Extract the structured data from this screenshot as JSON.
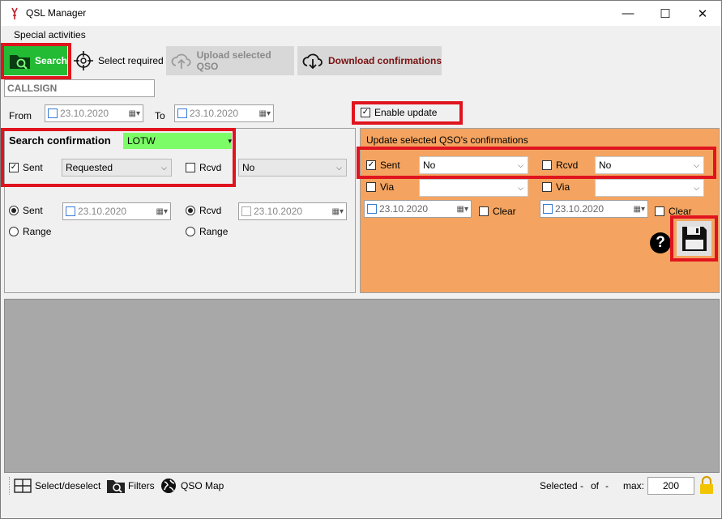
{
  "window": {
    "title": "QSL Manager",
    "minimize": "—",
    "maximize": "☐",
    "close": "✕"
  },
  "menu": {
    "special_activities": "Special activities"
  },
  "toolbar": {
    "search": "Search",
    "select_required": "Select required",
    "upload": "Upload selected QSO",
    "download": "Download confirmations"
  },
  "filters": {
    "callsign_placeholder": "CALLSIGN",
    "from_label": "From",
    "from_date": "23.10.2020",
    "to_label": "To",
    "to_date": "23.10.2020",
    "enable_update": "Enable update"
  },
  "search_conf": {
    "title": "Search confirmation",
    "service": "LOTW",
    "sent_label": "Sent",
    "sent_value": "Requested",
    "rcvd_label": "Rcvd",
    "rcvd_value": "No",
    "sent_radio": "Sent",
    "sent_date": "23.10.2020",
    "rcvd_radio": "Rcvd",
    "rcvd_date": "23.10.2020",
    "range1": "Range",
    "range2": "Range"
  },
  "update_conf": {
    "title": "Update selected QSO's confirmations",
    "sent_label": "Sent",
    "sent_value": "No",
    "rcvd_label": "Rcvd",
    "rcvd_value": "No",
    "via1": "Via",
    "via2": "Via",
    "date1": "23.10.2020",
    "clear1": "Clear",
    "date2": "23.10.2020",
    "clear2": "Clear",
    "help": "?"
  },
  "status": {
    "select_deselect": "Select/deselect",
    "filters": "Filters",
    "qso_map": "QSO Map",
    "selected": "Selected",
    "dash1": "-",
    "of": "of",
    "dash2": "-",
    "max": "max:",
    "max_value": "200"
  },
  "colors": {
    "search_green": "#22bb33",
    "update_orange": "#f4a460",
    "lotw_green": "#7cfc66",
    "highlight_red": "#e0141e"
  }
}
